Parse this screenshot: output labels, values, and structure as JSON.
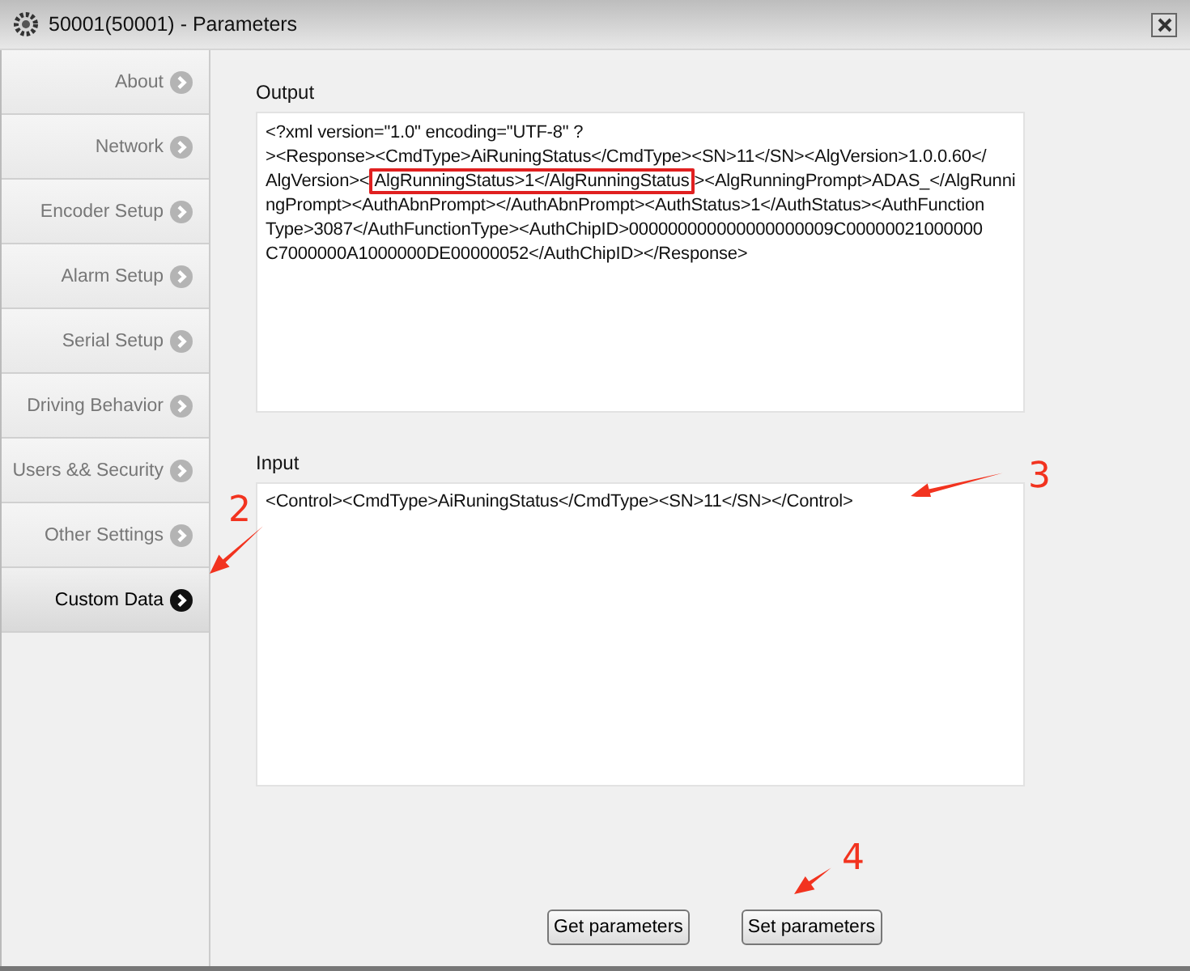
{
  "window": {
    "title": "50001(50001) - Parameters"
  },
  "sidebar": {
    "items": [
      {
        "label": "About",
        "selected": false
      },
      {
        "label": "Network",
        "selected": false
      },
      {
        "label": "Encoder Setup",
        "selected": false
      },
      {
        "label": "Alarm Setup",
        "selected": false
      },
      {
        "label": "Serial Setup",
        "selected": false
      },
      {
        "label": "Driving Behavior",
        "selected": false
      },
      {
        "label": "Users && Security",
        "selected": false
      },
      {
        "label": "Other Settings",
        "selected": false
      },
      {
        "label": "Custom Data",
        "selected": true
      }
    ]
  },
  "output": {
    "label": "Output",
    "lines": [
      {
        "parts": [
          {
            "text": "<?xml version=\"1.0\" encoding=\"UTF-8\" ?",
            "highlighted": false
          }
        ]
      },
      {
        "parts": [
          {
            "text": "><Response><CmdType>AiRuningStatus</CmdType><SN>11</SN><AlgVersion>1.0.0.60</",
            "highlighted": false
          }
        ]
      },
      {
        "parts": [
          {
            "text": "AlgVersion><",
            "highlighted": false
          },
          {
            "text": "AlgRunningStatus>1</AlgRunningStatus",
            "highlighted": true
          },
          {
            "text": "><AlgRunningPrompt>ADAS_</AlgRunni",
            "highlighted": false
          }
        ]
      },
      {
        "parts": [
          {
            "text": "ngPrompt><AuthAbnPrompt></AuthAbnPrompt><AuthStatus>1</AuthStatus><AuthFunction",
            "highlighted": false
          }
        ]
      },
      {
        "parts": [
          {
            "text": "Type>3087</AuthFunctionType><AuthChipID>000000000000000000009C00000021000000",
            "highlighted": false
          }
        ]
      },
      {
        "parts": [
          {
            "text": "C7000000A1000000DE00000052</AuthChipID></Response>",
            "highlighted": false
          }
        ]
      }
    ]
  },
  "input": {
    "label": "Input",
    "value": "<Control><CmdType>AiRuningStatus</CmdType><SN>11</SN></Control>"
  },
  "buttons": [
    "Get parameters",
    "Set parameters"
  ],
  "annotations": [
    {
      "label": "2"
    },
    {
      "label": "3"
    },
    {
      "label": "4"
    }
  ]
}
